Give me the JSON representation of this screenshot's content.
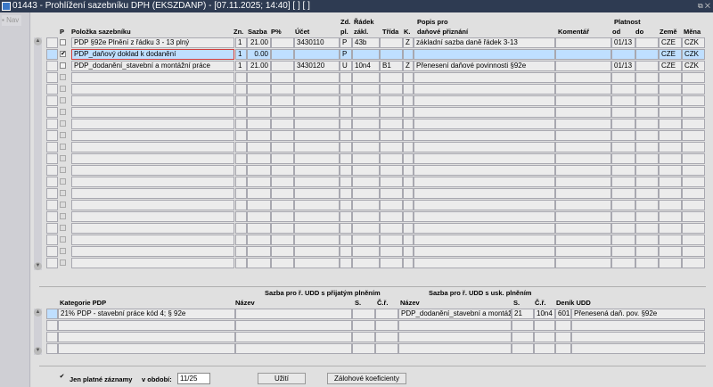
{
  "window": {
    "title": "01443 - Prohlížení sazebníku DPH (EKSZDANP) - [07.11.2025; 14:40]  [ ]  [ ]",
    "controls": "⧉ ✕"
  },
  "nav": {
    "label": "Nav"
  },
  "top_grid": {
    "headers": {
      "p": "P",
      "polozka": "Položka sazebníku",
      "zn": "Zn.",
      "sazba": "Sazba",
      "pp": "P%",
      "ucet": "Účet",
      "zd1": "Zd.",
      "zd2": "pl.",
      "radek1": "Řádek",
      "radek2": "zákl.",
      "trida": "Třída",
      "k": "K.",
      "popis1": "Popis pro",
      "popis2": "daňové přiznání",
      "komentar": "Komentář",
      "platnost": "Platnost",
      "od": "od",
      "do": "do",
      "zeme": "Země",
      "mena": "Měna"
    },
    "rows": [
      {
        "checked": false,
        "polozka": "PDP §92e Plnění z řádku 3 - 13 plný",
        "zn": "1",
        "sazba": "21.00",
        "pp": "",
        "ucet": "3430110",
        "zd": "P",
        "radek": "43b",
        "trida": "",
        "k": "Z",
        "popis": "základní sazba daně řádek 3-13",
        "komentar": "",
        "od": "01/13",
        "do": "",
        "zeme": "CZE",
        "mena": "CZK"
      },
      {
        "checked": true,
        "selected": true,
        "polozka": "PDP_daňový doklad k dodanění",
        "zn": "1",
        "sazba": "0.00",
        "pp": "",
        "ucet": "",
        "zd": "P",
        "radek": "",
        "trida": "",
        "k": "",
        "popis": "",
        "komentar": "",
        "od": "",
        "do": "",
        "zeme": "CZE",
        "mena": "CZK"
      },
      {
        "checked": false,
        "polozka": "PDP_dodanění_stavební a montážní práce",
        "zn": "1",
        "sazba": "21.00",
        "pp": "",
        "ucet": "3430120",
        "zd": "U",
        "radek": "10n4",
        "trida": "B1",
        "k": "Z",
        "popis": "Přenesení daňové povinnosti §92e",
        "komentar": "",
        "od": "01/13",
        "do": "",
        "zeme": "CZE",
        "mena": "CZK"
      }
    ]
  },
  "bottom_grid": {
    "headers": {
      "group1": "Sazba pro ř. UDD s přijatým plněním",
      "group2": "Sazba pro ř. UDD s usk. plněním",
      "kategorie": "Kategorie PDP",
      "nazev1": "Název",
      "s1": "S.",
      "cr1": "Č.ř.",
      "nazev2": "Název",
      "s2": "S.",
      "cr2": "Č.ř.",
      "denik": "Deník UDD"
    },
    "rows": [
      {
        "kategorie": "21% PDP - stavební práce kód 4; § 92e",
        "nazev1": "",
        "s1": "",
        "cr1": "",
        "nazev2": "PDP_dodanění_stavební a montážní",
        "s2": "21",
        "cr2": "10n4",
        "denik": "601",
        "denik_text": "Přenesená daň. pov. §92e"
      }
    ]
  },
  "footer": {
    "only_valid_label": "Jen platné záznamy",
    "only_valid_checked": true,
    "period_label": "v období:",
    "period_value": "11/25",
    "use_button": "Užití",
    "coef_button": "Zálohové koeficienty"
  }
}
